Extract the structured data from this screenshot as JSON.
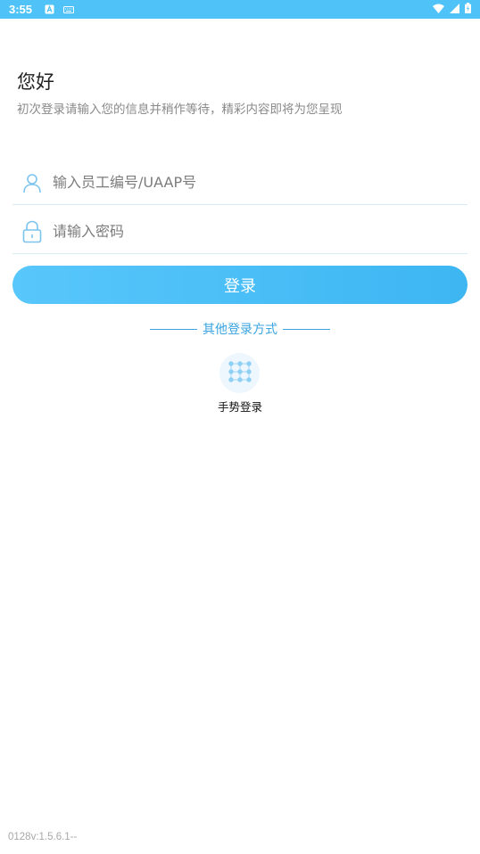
{
  "status_bar": {
    "time": "3:55",
    "icons": [
      "a-notification-icon",
      "keyboard-icon",
      "wifi-icon",
      "signal-icon",
      "battery-icon"
    ]
  },
  "header": {
    "greeting": "您好",
    "subtitle": "初次登录请输入您的信息并稍作等待，精彩内容即将为您呈现"
  },
  "form": {
    "user_placeholder": "输入员工编号/UAAP号",
    "password_placeholder": "请输入密码",
    "login_label": "登录"
  },
  "other_login": {
    "title": "其他登录方式",
    "gesture_label": "手势登录"
  },
  "footer": {
    "version": "0128v:1.5.6.1--"
  },
  "colors": {
    "accent": "#4fc3f7",
    "link": "#3aa4e0",
    "icon": "#7cc3ee"
  }
}
